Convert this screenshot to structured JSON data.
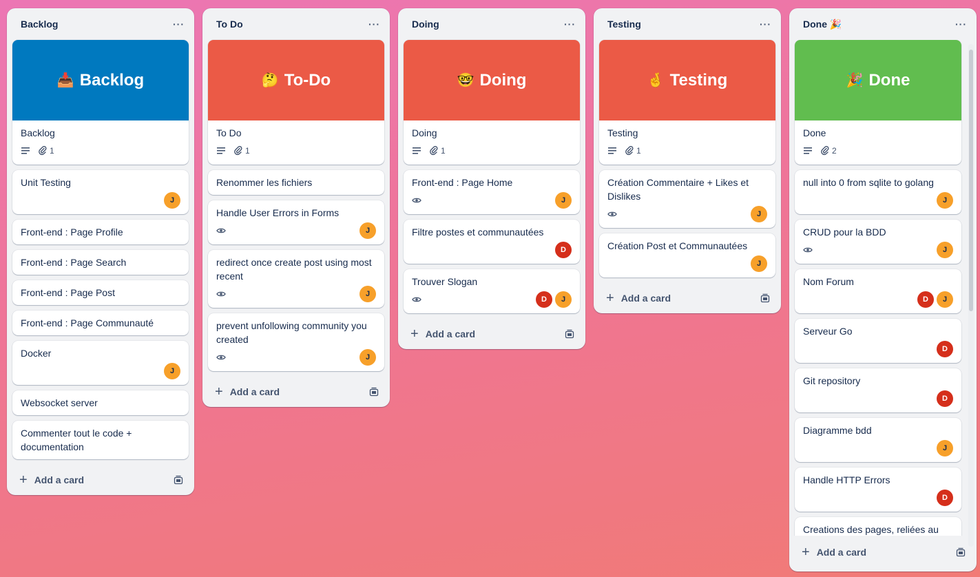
{
  "lists": [
    {
      "title": "Backlog",
      "cover": {
        "emoji": "📥",
        "text": "Backlog",
        "color": "#0079bf"
      },
      "cards": [
        {
          "title": "Backlog",
          "attachments": "1"
        },
        {
          "title": "Unit Testing",
          "members": [
            "J"
          ]
        },
        {
          "title": "Front-end : Page Profile"
        },
        {
          "title": "Front-end : Page Search"
        },
        {
          "title": "Front-end : Page Post"
        },
        {
          "title": "Front-end : Page Communauté"
        },
        {
          "title": "Docker",
          "members": [
            "J"
          ]
        },
        {
          "title": "Websocket server"
        },
        {
          "title": "Commenter tout le code + documentation"
        }
      ],
      "add_label": "Add a card"
    },
    {
      "title": "To Do",
      "cover": {
        "emoji": "🤔",
        "text": "To-Do",
        "color": "#eb5a46"
      },
      "cards": [
        {
          "title": "To Do",
          "attachments": "1"
        },
        {
          "title": "Renommer les fichiers"
        },
        {
          "title": "Handle User Errors in Forms",
          "members": [
            "J"
          ]
        },
        {
          "title": "redirect once create post using most recent",
          "members": [
            "J"
          ]
        },
        {
          "title": "prevent unfollowing community you created",
          "members": [
            "J"
          ]
        }
      ],
      "add_label": "Add a card"
    },
    {
      "title": "Doing",
      "cover": {
        "emoji": "🤓",
        "text": "Doing",
        "color": "#eb5a46"
      },
      "cards": [
        {
          "title": "Doing",
          "attachments": "1"
        },
        {
          "title": "Front-end : Page Home",
          "members": [
            "J"
          ]
        },
        {
          "title": "Filtre postes et communautées",
          "members": [
            "D"
          ]
        },
        {
          "title": "Trouver Slogan",
          "members": [
            "D",
            "J"
          ]
        }
      ],
      "add_label": "Add a card"
    },
    {
      "title": "Testing",
      "cover": {
        "emoji": "🤞",
        "text": "Testing",
        "color": "#eb5a46"
      },
      "cards": [
        {
          "title": "Testing",
          "attachments": "1"
        },
        {
          "title": "Création Commentaire + Likes et Dislikes",
          "members": [
            "J"
          ]
        },
        {
          "title": "Création Post et Communautées",
          "members": [
            "J"
          ]
        }
      ],
      "add_label": "Add a card"
    },
    {
      "title": "Done 🎉",
      "cover": {
        "emoji": "🎉",
        "text": "Done",
        "color": "#61bd4f"
      },
      "cards": [
        {
          "title": "Done",
          "attachments": "2"
        },
        {
          "title": "null into 0 from sqlite to golang",
          "members": [
            "J"
          ]
        },
        {
          "title": "CRUD pour la BDD",
          "members": [
            "J"
          ]
        },
        {
          "title": "Nom Forum",
          "members": [
            "D",
            "J"
          ]
        },
        {
          "title": "Serveur Go",
          "members": [
            "D"
          ]
        },
        {
          "title": "Git repository",
          "members": [
            "D"
          ]
        },
        {
          "title": "Diagramme bdd",
          "members": [
            "J"
          ]
        },
        {
          "title": "Handle HTTP Errors",
          "members": [
            "D"
          ]
        },
        {
          "title": "Creations des pages, reliées au css"
        }
      ],
      "add_label": "Add a card"
    }
  ]
}
